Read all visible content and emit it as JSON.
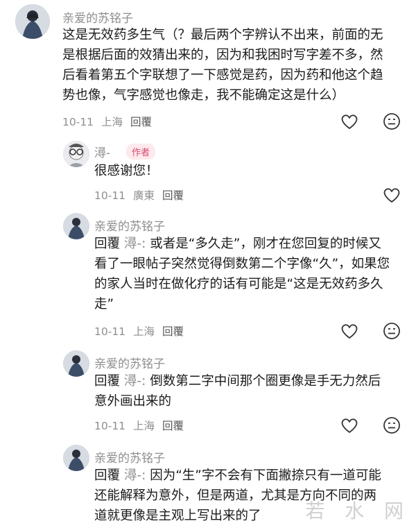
{
  "comments": [
    {
      "username": "亲爱的苏铭子",
      "lines": [
        "这是无效药多生气（？最后两个字辨认不出来，前面的无",
        "是根据后面的效猜出来的，因为和我困时写字差不多，然",
        "后看着第五个字联想了一下感觉是药，因为药和他这个趋",
        "势也像，气字感觉也像走，我不能确定这是什么）"
      ],
      "date": "10-11",
      "location": "上海",
      "reply_label": "回覆",
      "like_icon": "heart-icon",
      "dislike_icon": "neutral-face-icon"
    },
    {
      "username": "潯-",
      "badge": "作者",
      "lines": [
        "很感谢您！"
      ],
      "date": "10-11",
      "location": "廣東",
      "reply_label": "回覆",
      "like_icon": "heart-icon"
    },
    {
      "username": "亲爱的苏铭子",
      "reply_prefix": "回覆",
      "reply_target": "潯-:",
      "first_line_rest": " 或者是“多久走”，刚才在您回复的时候又",
      "lines": [
        "看了一眼帖子突然觉得倒数第二个字像“久”，如果您",
        "的家人当时在做化疗的话有可能是“这是无效药多久",
        "走”"
      ],
      "date": "10-11",
      "location": "上海",
      "reply_label": "回覆"
    },
    {
      "username": "亲爱的苏铭子",
      "reply_prefix": "回覆",
      "reply_target": "潯-:",
      "first_line_rest": " 倒数第二字中间那个圈更像是手无力然后",
      "lines": [
        "意外画出来的"
      ],
      "date": "10-11",
      "location": "上海",
      "reply_label": "回覆"
    },
    {
      "username": "亲爱的苏铭子",
      "reply_prefix": "回覆",
      "reply_target": "潯-:",
      "first_line_rest": " 因为“生”字不会有下面撇捺只有一道可能",
      "lines": [
        "还能解释为意外，但是两道，尤其是方向不同的两",
        "道就更像是主观上写出来的了"
      ]
    }
  ],
  "watermark": "若 水 网"
}
